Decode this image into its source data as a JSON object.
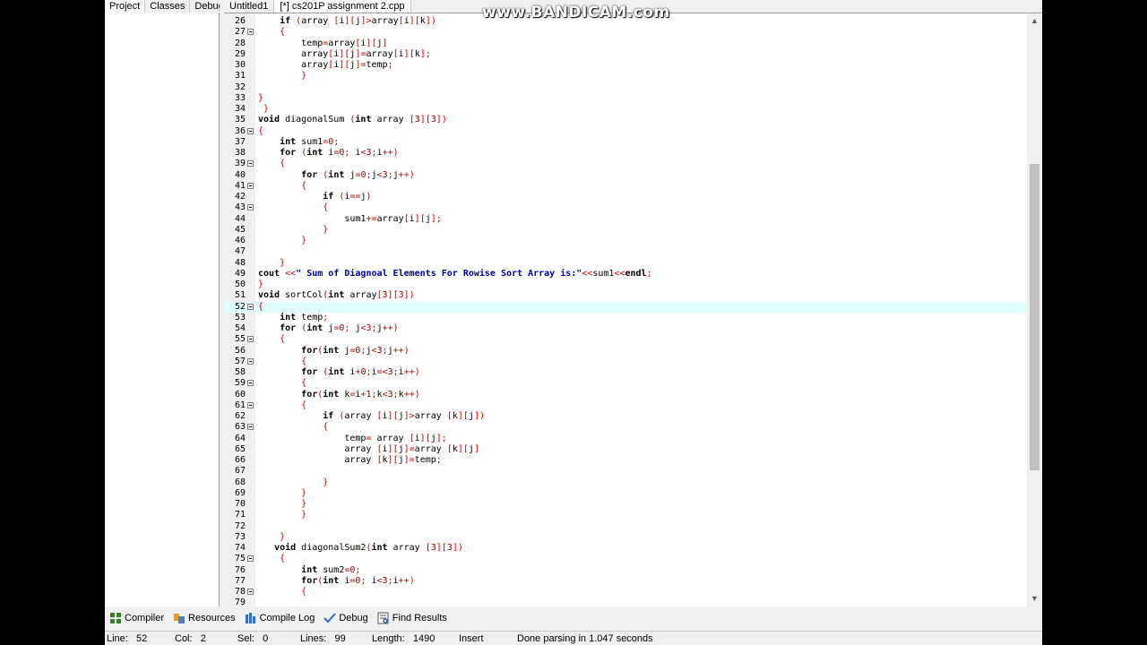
{
  "watermark": "www.BANDICAM.com",
  "left_tabs": [
    {
      "label": "Project",
      "active": true
    },
    {
      "label": "Classes",
      "active": false
    },
    {
      "label": "Debug",
      "active": false
    }
  ],
  "editor_tabs": [
    {
      "label": "Untitled1",
      "active": false
    },
    {
      "label": "[*] cs201P assignment 2.cpp",
      "active": true
    }
  ],
  "code": [
    {
      "n": "26",
      "fold": false,
      "text": "    if (array [i][j]>array[i][k])"
    },
    {
      "n": "27",
      "fold": true,
      "text": "    {"
    },
    {
      "n": "28",
      "fold": false,
      "text": "        temp=array[i][j]"
    },
    {
      "n": "29",
      "fold": false,
      "text": "        array[i][j]=array[i][k];"
    },
    {
      "n": "30",
      "fold": false,
      "text": "        array[i][j]=temp;"
    },
    {
      "n": "31",
      "fold": false,
      "text": "        }"
    },
    {
      "n": "32",
      "fold": false,
      "text": ""
    },
    {
      "n": "33",
      "fold": false,
      "text": "}"
    },
    {
      "n": "34",
      "fold": false,
      "text": " }"
    },
    {
      "n": "35",
      "fold": false,
      "text": "void diagonalSum (int array [3][3])"
    },
    {
      "n": "36",
      "fold": true,
      "text": "{"
    },
    {
      "n": "37",
      "fold": false,
      "text": "    int sum1=0;"
    },
    {
      "n": "38",
      "fold": false,
      "text": "    for (int i=0; i<3;i++)"
    },
    {
      "n": "39",
      "fold": true,
      "text": "    {"
    },
    {
      "n": "40",
      "fold": false,
      "text": "        for (int j=0;j<3;j++)"
    },
    {
      "n": "41",
      "fold": true,
      "text": "        {"
    },
    {
      "n": "42",
      "fold": false,
      "text": "            if (i==j)"
    },
    {
      "n": "43",
      "fold": true,
      "text": "            {"
    },
    {
      "n": "44",
      "fold": false,
      "text": "                sum1+=array[i][j];"
    },
    {
      "n": "45",
      "fold": false,
      "text": "            }"
    },
    {
      "n": "46",
      "fold": false,
      "text": "        }"
    },
    {
      "n": "47",
      "fold": false,
      "text": ""
    },
    {
      "n": "48",
      "fold": false,
      "text": "    }"
    },
    {
      "n": "49",
      "fold": false,
      "text": "cout <<\" Sum of Diagnoal Elements For Rowise Sort Array is:\"<<sum1<<endl;"
    },
    {
      "n": "50",
      "fold": false,
      "text": "}"
    },
    {
      "n": "51",
      "fold": false,
      "text": "void sortCol(int array[3][3])"
    },
    {
      "n": "52",
      "fold": true,
      "text": "{",
      "current": true
    },
    {
      "n": "53",
      "fold": false,
      "text": "    int temp;"
    },
    {
      "n": "54",
      "fold": false,
      "text": "    for (int j=0; j<3;j++)"
    },
    {
      "n": "55",
      "fold": true,
      "text": "    {"
    },
    {
      "n": "56",
      "fold": false,
      "text": "        for(int j=0;j<3;j++)"
    },
    {
      "n": "57",
      "fold": true,
      "text": "        {"
    },
    {
      "n": "58",
      "fold": false,
      "text": "        for (int i+0;i=<3;i++)"
    },
    {
      "n": "59",
      "fold": true,
      "text": "        {"
    },
    {
      "n": "60",
      "fold": false,
      "text": "        for(int k=i+1;k<3;k++)"
    },
    {
      "n": "61",
      "fold": true,
      "text": "        {"
    },
    {
      "n": "62",
      "fold": false,
      "text": "            if (array [i][j]>array [k][j])"
    },
    {
      "n": "63",
      "fold": true,
      "text": "            {"
    },
    {
      "n": "64",
      "fold": false,
      "text": "                temp= array [i][j];"
    },
    {
      "n": "65",
      "fold": false,
      "text": "                array [i][j]=array [k][j]"
    },
    {
      "n": "66",
      "fold": false,
      "text": "                array [k][j]=temp;"
    },
    {
      "n": "67",
      "fold": false,
      "text": ""
    },
    {
      "n": "68",
      "fold": false,
      "text": "            }"
    },
    {
      "n": "69",
      "fold": false,
      "text": "        }"
    },
    {
      "n": "70",
      "fold": false,
      "text": "        }"
    },
    {
      "n": "71",
      "fold": false,
      "text": "        }"
    },
    {
      "n": "72",
      "fold": false,
      "text": ""
    },
    {
      "n": "73",
      "fold": false,
      "text": "    }"
    },
    {
      "n": "74",
      "fold": false,
      "text": "   void diagonalSum2(int array [3][3])"
    },
    {
      "n": "75",
      "fold": true,
      "text": "    {"
    },
    {
      "n": "76",
      "fold": false,
      "text": "        int sum2=0;"
    },
    {
      "n": "77",
      "fold": false,
      "text": "        for(int i=0; i<3;i++)"
    },
    {
      "n": "78",
      "fold": true,
      "text": "        {"
    },
    {
      "n": "79",
      "fold": false,
      "text": ""
    }
  ],
  "bottom_tabs": [
    {
      "label": "Compiler",
      "icon": "compiler-icon"
    },
    {
      "label": "Resources",
      "icon": "resources-icon"
    },
    {
      "label": "Compile Log",
      "icon": "compile-log-icon"
    },
    {
      "label": "Debug",
      "icon": "debug-icon"
    },
    {
      "label": "Find Results",
      "icon": "find-results-icon"
    }
  ],
  "status": {
    "line_label": "Line:",
    "line_value": "52",
    "col_label": "Col:",
    "col_value": "2",
    "sel_label": "Sel:",
    "sel_value": "0",
    "lines_label": "Lines:",
    "lines_value": "99",
    "length_label": "Length:",
    "length_value": "1490",
    "mode": "Insert",
    "message": "Done parsing in 1.047 seconds"
  },
  "colors": {
    "current_line": "#e0ffff",
    "keyword": "#000000",
    "symbol": "#d00000",
    "string": "#0000a0"
  }
}
